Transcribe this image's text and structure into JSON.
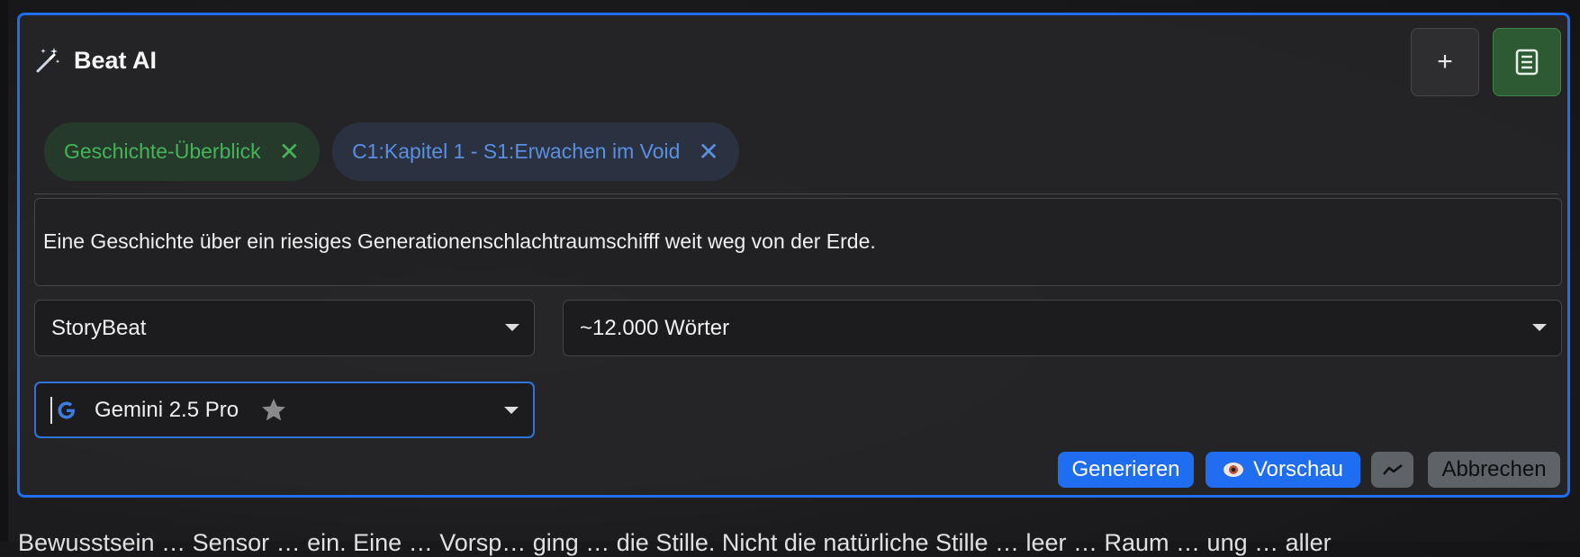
{
  "panel": {
    "title": "Beat AI",
    "header_buttons": [
      {
        "name": "add-button",
        "icon": "plus-icon",
        "label": "+"
      },
      {
        "name": "notebook-button",
        "icon": "notebook-icon"
      }
    ]
  },
  "context_chips": [
    {
      "label": "Geschichte-Überblick",
      "color": "#46b35a"
    },
    {
      "label": "C1:Kapitel 1 - S1:Erwachen im Void",
      "color": "#5b8fe0"
    }
  ],
  "prompt_text": "Eine Geschichte über ein riesiges Generationenschlachtraumschifff weit weg von der Erde.",
  "selects": {
    "beat_type": "StoryBeat",
    "word_count": "~12.000 Wörter",
    "model": "Gemini 2.5 Pro"
  },
  "actions": {
    "generate": "Generieren",
    "preview": "Vorschau",
    "cancel": "Abbrechen"
  },
  "icons": {
    "title": "magic-wand-icon",
    "model_provider": "google-icon",
    "favorite": "star-icon",
    "preview": "eye-icon",
    "stats": "line-chart-icon"
  },
  "colors": {
    "accent": "#1f6df0",
    "panel_border": "#1f6df0",
    "secondary_button": "#5f6368"
  },
  "below_text": "Bewusstsein … Sensor … ein. Eine … Vorsp… ging … die Stille. Nicht die natürliche Stille … leer … Raum … ung … aller"
}
